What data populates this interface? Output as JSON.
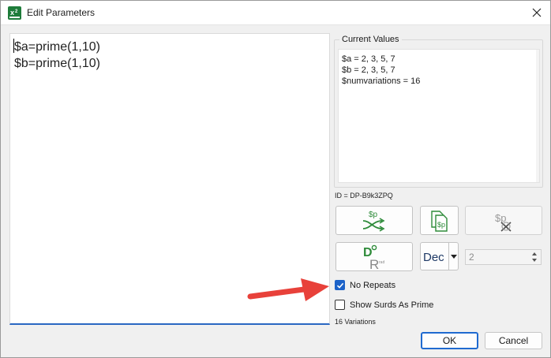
{
  "window": {
    "title": "Edit Parameters",
    "accent_color": "#1f6ad0",
    "icons": {
      "app": "app-logo-icon",
      "close": "close-icon"
    }
  },
  "editor": {
    "lines": [
      "$a=prime(1,10)",
      "$b=prime(1,10)"
    ]
  },
  "current_values": {
    "label": "Current Values",
    "lines": [
      "$a = 2, 3, 5, 7",
      "$b = 2, 3, 5, 7",
      "$numvariations = 16"
    ]
  },
  "id_text": "ID = DP-B9k3ZPQ",
  "toolbar": {
    "shuffle_icon": "shuffle-parameters-icon",
    "copy_icon": "copy-parameters-icon",
    "clear_icon": "clear-parameters-icon",
    "degrees_icon": "degrees-radians-icon",
    "dec_label": "Dec",
    "decimals_value": "2"
  },
  "options": {
    "no_repeats_label": "No Repeats",
    "no_repeats_checked": true,
    "surds_label": "Show Surds As Prime",
    "surds_checked": false
  },
  "variations_text": "16 Variations",
  "buttons": {
    "ok": "OK",
    "cancel": "Cancel"
  },
  "annotation": {
    "arrow_color": "#e8413a"
  }
}
